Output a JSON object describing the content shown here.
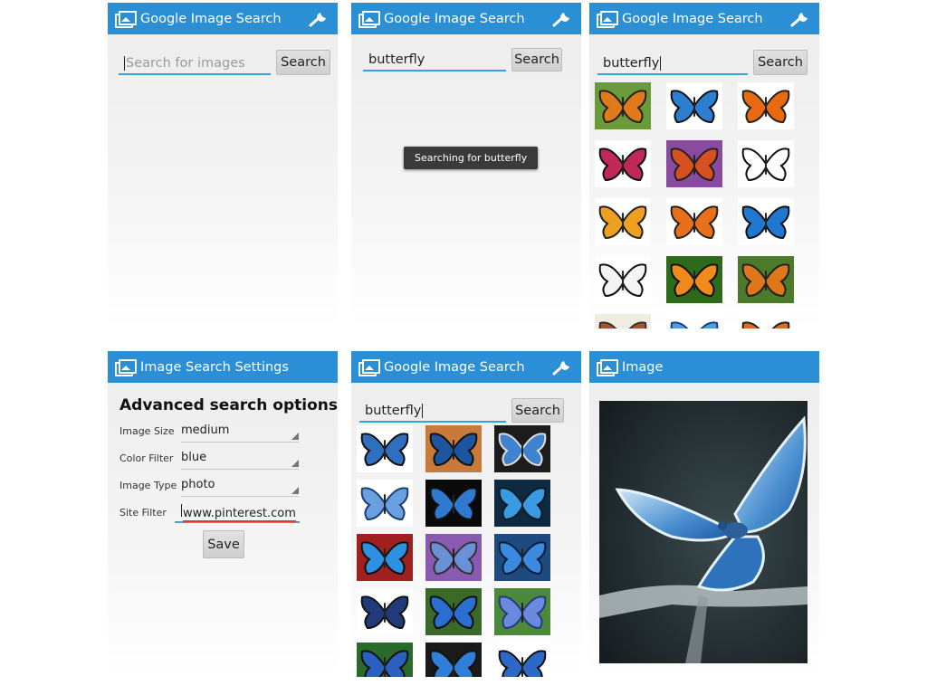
{
  "screens": {
    "s1": {
      "title": "Google Image Search",
      "search_placeholder": "Search for images",
      "search_value": "",
      "search_button": "Search"
    },
    "s2": {
      "title": "Google Image Search",
      "search_value": "butterfly",
      "search_button": "Search",
      "toast": "Searching for butterfly"
    },
    "s3": {
      "title": "Google Image Search",
      "search_value": "butterfly",
      "search_button": "Search",
      "results_count_visible": 15
    },
    "s4": {
      "title": "Image Search Settings",
      "heading": "Advanced search options",
      "fields": [
        {
          "label": "Image Size",
          "value": "medium"
        },
        {
          "label": "Color Filter",
          "value": "blue"
        },
        {
          "label": "Image Type",
          "value": "photo"
        }
      ],
      "site_filter_label": "Site Filter",
      "site_filter_value": "www.pinterest.com",
      "save_button": "Save"
    },
    "s5": {
      "title": "Google Image Search",
      "search_value": "butterfly",
      "search_button": "Search",
      "results_count_visible": 15
    },
    "s6": {
      "title": "Image"
    }
  },
  "icons": [
    "app-gallery-icon",
    "wrench-settings-icon",
    "dropdown-triangle-icon"
  ],
  "colors": {
    "action_bar": "#2b8fd6",
    "input_underline": "#33a3dc",
    "toast_bg": "#3a3a3a",
    "spellcheck_underline": "#e53935"
  }
}
